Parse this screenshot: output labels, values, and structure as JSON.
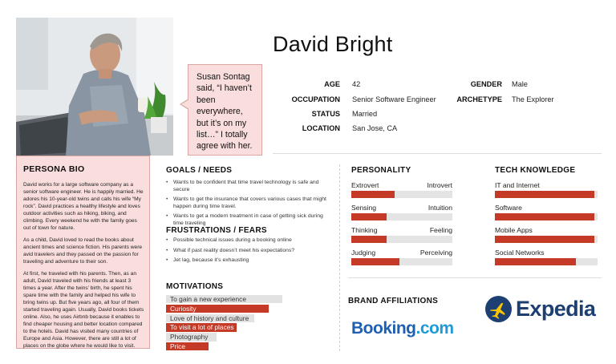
{
  "persona": {
    "name": "David Bright",
    "quote": "Susan Sontag said, “I haven’t been everywhere, but it’s on my list…” I totally agree with her."
  },
  "info": {
    "age_label": "AGE",
    "age": "42",
    "occupation_label": "OCCUPATION",
    "occupation": "Senior Software Engineer",
    "status_label": "STATUS",
    "status": "Married",
    "location_label": "LOCATION",
    "location": "San Jose, CA",
    "gender_label": "GENDER",
    "gender": "Male",
    "archetype_label": "ARCHETYPE",
    "archetype": "The Explorer"
  },
  "bio": {
    "title": "PERSONA BIO",
    "paragraphs": [
      "David works for a large software company as a senior software engineer. He is happily married. He adores his 10-year-old twins and calls his wife “My rock”. David practices a healthy lifestyle and loves outdoor activities such as hiking, biking, and climbing. Every weekend he with the family goes out of town for nature.",
      "As a child, David loved to read the books about ancient times and science fiction. His parents were avid travelers and they passed on the passion for traveling and adventure to their son.",
      "At first, he traveled with his parents. Then, as an adult, David traveled with his friends at least 3 times a year. After the twins’ birth, he spent his spare time with the family and helped his wife to bring twins up. But five years ago, all four of them started traveling again. Usually, David books tickets online. Also, he uses Airbnb because it enables to find cheaper housing and better location compared to the hotels. David has visited many countries of Europe and Asia. However, there are still a lot of places on the globe where he would like to visit."
    ]
  },
  "goals": {
    "title": "GOALS / NEEDS",
    "items": [
      "Wants to be confident that time travel technology is safe and secure",
      "Wants to get the insurance that covers various cases that might happen during time travel.",
      "Wants to get a modern treatment in case of getting sick during time traveling"
    ]
  },
  "frustrations": {
    "title": "FRUSTRATIONS / FEARS",
    "items": [
      "Possible technical issues during a booking online",
      "What if past reality doesn’t meet his expectations?",
      "Jet lag, because it’s exhausting"
    ]
  },
  "motivations": {
    "title": "MOTIVATIONS",
    "items": [
      {
        "label": "To gain a new experience",
        "level": 0.83,
        "highlight": false
      },
      {
        "label": "Curiosity",
        "level": 0.73,
        "highlight": true
      },
      {
        "label": "Love of history and culture",
        "level": 0.63,
        "highlight": false
      },
      {
        "label": "To visit a lot of places",
        "level": 0.5,
        "highlight": true
      },
      {
        "label": "Photography",
        "level": 0.36,
        "highlight": false
      },
      {
        "label": "Price",
        "level": 0.3,
        "highlight": true
      }
    ]
  },
  "personality": {
    "title": "PERSONALITY",
    "traits": [
      {
        "left": "Extrovert",
        "right": "Introvert",
        "level": 0.43
      },
      {
        "left": "Sensing",
        "right": "Intuition",
        "level": 0.35
      },
      {
        "left": "Thinking",
        "right": "Feeling",
        "level": 0.35
      },
      {
        "left": "Judging",
        "right": "Perceiving",
        "level": 0.48
      }
    ]
  },
  "tech": {
    "title": "TECH KNOWLEDGE",
    "items": [
      {
        "label": "IT and Internet",
        "level": 0.97
      },
      {
        "label": "Software",
        "level": 0.97
      },
      {
        "label": "Mobile Apps",
        "level": 0.97
      },
      {
        "label": "Social Networks",
        "level": 0.79
      }
    ]
  },
  "brands": {
    "title": "BRAND AFFILIATIONS",
    "booking_main": "Booking",
    "booking_dot": ".",
    "booking_com": "com",
    "expedia": "Expedia"
  },
  "colors": {
    "accent": "#c43a26",
    "panel": "#f9dedd",
    "panel_border": "#d9a6a4",
    "booking": "#1f5fb0",
    "expedia": "#1d3f72"
  }
}
